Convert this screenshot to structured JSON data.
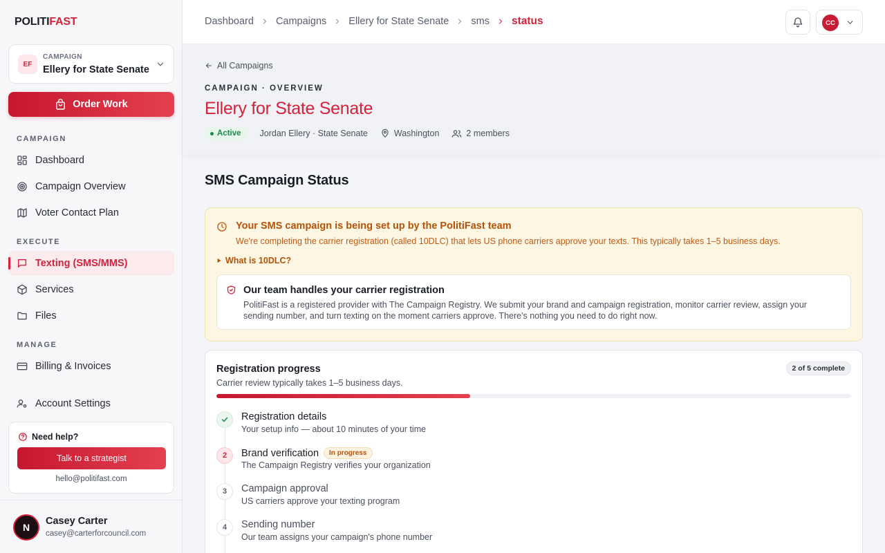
{
  "sidebar": {
    "logo_a": "POLITI",
    "logo_b": "FAST",
    "campaign": {
      "initials": "EF",
      "caption": "CAMPAIGN",
      "name": "Ellery for State Senate"
    },
    "order_label": "Order Work",
    "sections": {
      "campaign": "CAMPAIGN",
      "execute": "EXECUTE",
      "manage": "MANAGE"
    },
    "items": {
      "dashboard": "Dashboard",
      "overview": "Campaign Overview",
      "voter": "Voter Contact Plan",
      "texting": "Texting (SMS/MMS)",
      "services": "Services",
      "files": "Files",
      "billing": "Billing & Invoices",
      "account": "Account Settings"
    },
    "help": {
      "title": "Need help?",
      "button": "Talk to a strategist",
      "email": "hello@politifast.com"
    },
    "user": {
      "initial": "N",
      "name": "Casey Carter",
      "email": "casey@carterforcouncil.com"
    }
  },
  "topbar": {
    "crumbs": [
      "Dashboard",
      "Campaigns",
      "Ellery for State Senate",
      "sms"
    ],
    "current": "status",
    "account_initials": "CC"
  },
  "header": {
    "back": "All Campaigns",
    "overline": "CAMPAIGN · OVERVIEW",
    "title": "Ellery for State Senate",
    "status": "Active",
    "candidate": "Jordan Ellery · State Senate",
    "location": "Washington",
    "members": "2 members"
  },
  "main": {
    "title": "SMS Campaign Status",
    "alert": {
      "title": "Your SMS campaign is being set up by the PolitiFast team",
      "desc": "We're completing the carrier registration (called 10DLC) that lets US phone carriers approve your texts. This typically takes 1–5 business days.",
      "disclosure": "What is 10DLC?",
      "inner_title": "Our team handles your carrier registration",
      "inner_desc": "PolitiFast is a registered provider with The Campaign Registry. We submit your brand and campaign registration, monitor carrier review, assign your sending number, and turn texting on the moment carriers approve. There's nothing you need to do right now."
    },
    "progress": {
      "title": "Registration progress",
      "subtitle": "Carrier review typically takes 1–5 business days.",
      "count": "2 of 5 complete",
      "fraction": 0.4,
      "steps": [
        {
          "num": "",
          "name": "Registration details",
          "desc": "Your setup info — about 10 minutes of your time",
          "state": "done"
        },
        {
          "num": "2",
          "name": "Brand verification",
          "desc": "The Campaign Registry verifies your organization",
          "state": "current",
          "badge": "In progress"
        },
        {
          "num": "3",
          "name": "Campaign approval",
          "desc": "US carriers approve your texting program",
          "state": "pending"
        },
        {
          "num": "4",
          "name": "Sending number",
          "desc": "Our team assigns your campaign's phone number",
          "state": "pending"
        }
      ]
    }
  },
  "colors": {
    "accent": "#d4223a",
    "warning": "#b65208",
    "success": "#1c8a45"
  }
}
